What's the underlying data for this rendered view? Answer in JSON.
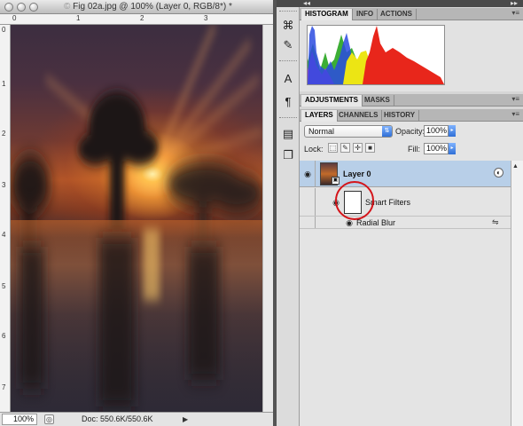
{
  "document": {
    "title_prefix": "©",
    "title": "Fig 02a.jpg @ 100% (Layer 0, RGB/8*) *",
    "ruler_top_numbers": [
      "0",
      "1",
      "2",
      "3"
    ],
    "ruler_left_numbers": [
      "0",
      "1",
      "2",
      "3",
      "4",
      "5",
      "6",
      "7"
    ],
    "zoom": "100%",
    "doc_info": "Doc: 550.6K/550.6K"
  },
  "histogram_panel": {
    "tabs": [
      "HISTOGRAM",
      "INFO",
      "ACTIONS"
    ],
    "active_tab": "HISTOGRAM"
  },
  "adjustments_panel": {
    "tabs": [
      "ADJUSTMENTS",
      "MASKS"
    ],
    "active_tab": "ADJUSTMENTS"
  },
  "layers_panel": {
    "tabs": [
      "LAYERS",
      "CHANNELS",
      "HISTORY"
    ],
    "active_tab": "LAYERS",
    "blend_mode": "Normal",
    "opacity_label": "Opacity:",
    "opacity_value": "100%",
    "lock_label": "Lock:",
    "fill_label": "Fill:",
    "fill_value": "100%",
    "layers": [
      {
        "name": "Layer 0",
        "selected": true
      },
      {
        "name": "Smart Filters"
      },
      {
        "name": "Radial Blur"
      }
    ]
  },
  "colors": {
    "selection": "#b8cfe8",
    "highlight_circle": "#d4141a",
    "histogram_red": "#e8261b",
    "histogram_yellow": "#ece514",
    "histogram_green": "#3cae35",
    "histogram_blue": "#2b4be0",
    "histogram_magenta": "#c43cc8"
  },
  "tools": [
    "warp-tool-icon",
    "brush-icon",
    "clone-icon",
    "text-character-icon",
    "paragraph-icon",
    "notes-icon",
    "copy-icon"
  ]
}
